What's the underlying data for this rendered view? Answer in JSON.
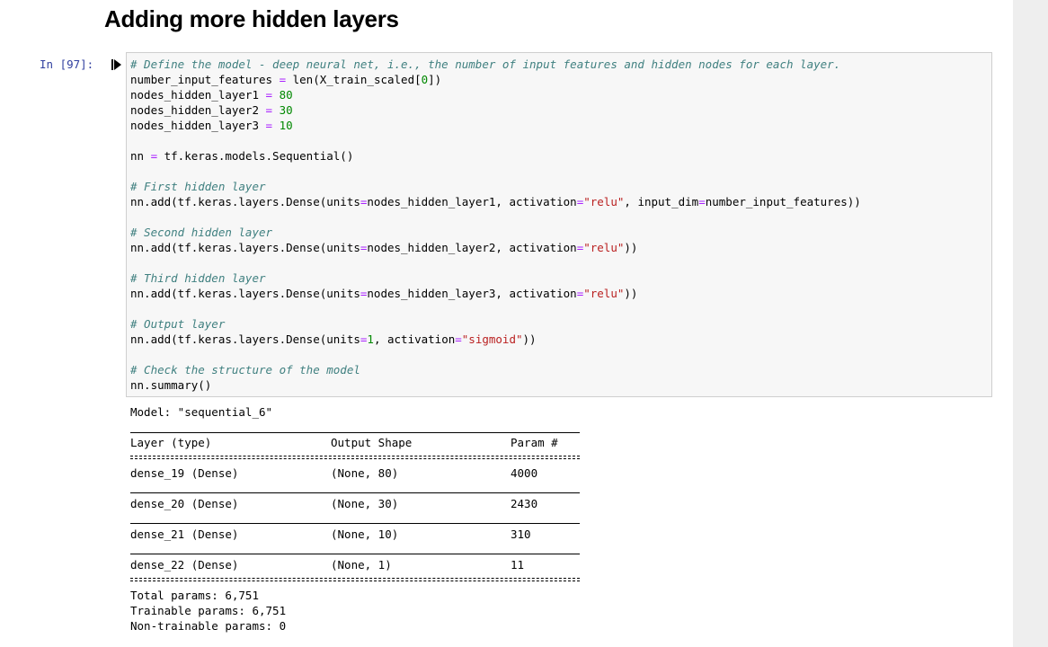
{
  "heading": "Adding more hidden layers",
  "cell": {
    "prompt": "In [97]:",
    "code": {
      "line1_comment": "# Define the model - deep neural net, i.e., the number of input features and hidden nodes for each layer.",
      "line2_a": "number_input_features ",
      "line2_op": "=",
      "line2_b": " len(X_train_scaled[",
      "line2_num": "0",
      "line2_c": "])",
      "line3_a": "nodes_hidden_layer1 ",
      "line3_op": "=",
      "line3_sp": " ",
      "line3_num": "80",
      "line4_a": "nodes_hidden_layer2 ",
      "line4_op": "=",
      "line4_sp": " ",
      "line4_num": "30",
      "line5_a": "nodes_hidden_layer3 ",
      "line5_op": "=",
      "line5_sp": " ",
      "line5_num": "10",
      "line7_a": "nn ",
      "line7_op": "=",
      "line7_b": " tf.keras.models.Sequential()",
      "line9_comment": "# First hidden layer",
      "line10_a": "nn.add(tf.keras.layers.Dense(units",
      "line10_op1": "=",
      "line10_b": "nodes_hidden_layer1, activation",
      "line10_op2": "=",
      "line10_str": "\"relu\"",
      "line10_c": ", input_dim",
      "line10_op3": "=",
      "line10_d": "number_input_features))",
      "line12_comment": "# Second hidden layer",
      "line13_a": "nn.add(tf.keras.layers.Dense(units",
      "line13_op1": "=",
      "line13_b": "nodes_hidden_layer2, activation",
      "line13_op2": "=",
      "line13_str": "\"relu\"",
      "line13_c": "))",
      "line15_comment": "# Third hidden layer",
      "line16_a": "nn.add(tf.keras.layers.Dense(units",
      "line16_op1": "=",
      "line16_b": "nodes_hidden_layer3, activation",
      "line16_op2": "=",
      "line16_str": "\"relu\"",
      "line16_c": "))",
      "line18_comment": "# Output layer",
      "line19_a": "nn.add(tf.keras.layers.Dense(units",
      "line19_op1": "=",
      "line19_num": "1",
      "line19_b": ", activation",
      "line19_op2": "=",
      "line19_str": "\"sigmoid\"",
      "line19_c": "))",
      "line21_comment": "# Check the structure of the model",
      "line22": "nn.summary()"
    }
  },
  "output": {
    "model_line": "Model: \"sequential_6\"",
    "headers": [
      "Layer (type)",
      "Output Shape",
      "Param #"
    ],
    "rows": [
      [
        "dense_19 (Dense)",
        "(None, 80)",
        "4000"
      ],
      [
        "dense_20 (Dense)",
        "(None, 30)",
        "2430"
      ],
      [
        "dense_21 (Dense)",
        "(None, 10)",
        "310"
      ],
      [
        "dense_22 (Dense)",
        "(None, 1)",
        "11"
      ]
    ],
    "total_params": "Total params: 6,751",
    "trainable_params": "Trainable params: 6,751",
    "non_trainable_params": "Non-trainable params: 0"
  },
  "colors": {
    "prompt": "#303f9f",
    "comment": "#408080",
    "operator": "#aa22ff",
    "number": "#008800",
    "string": "#ba2121",
    "cell_background": "#f7f7f7"
  },
  "icons": {
    "run_marker": "step-cursor-icon"
  }
}
